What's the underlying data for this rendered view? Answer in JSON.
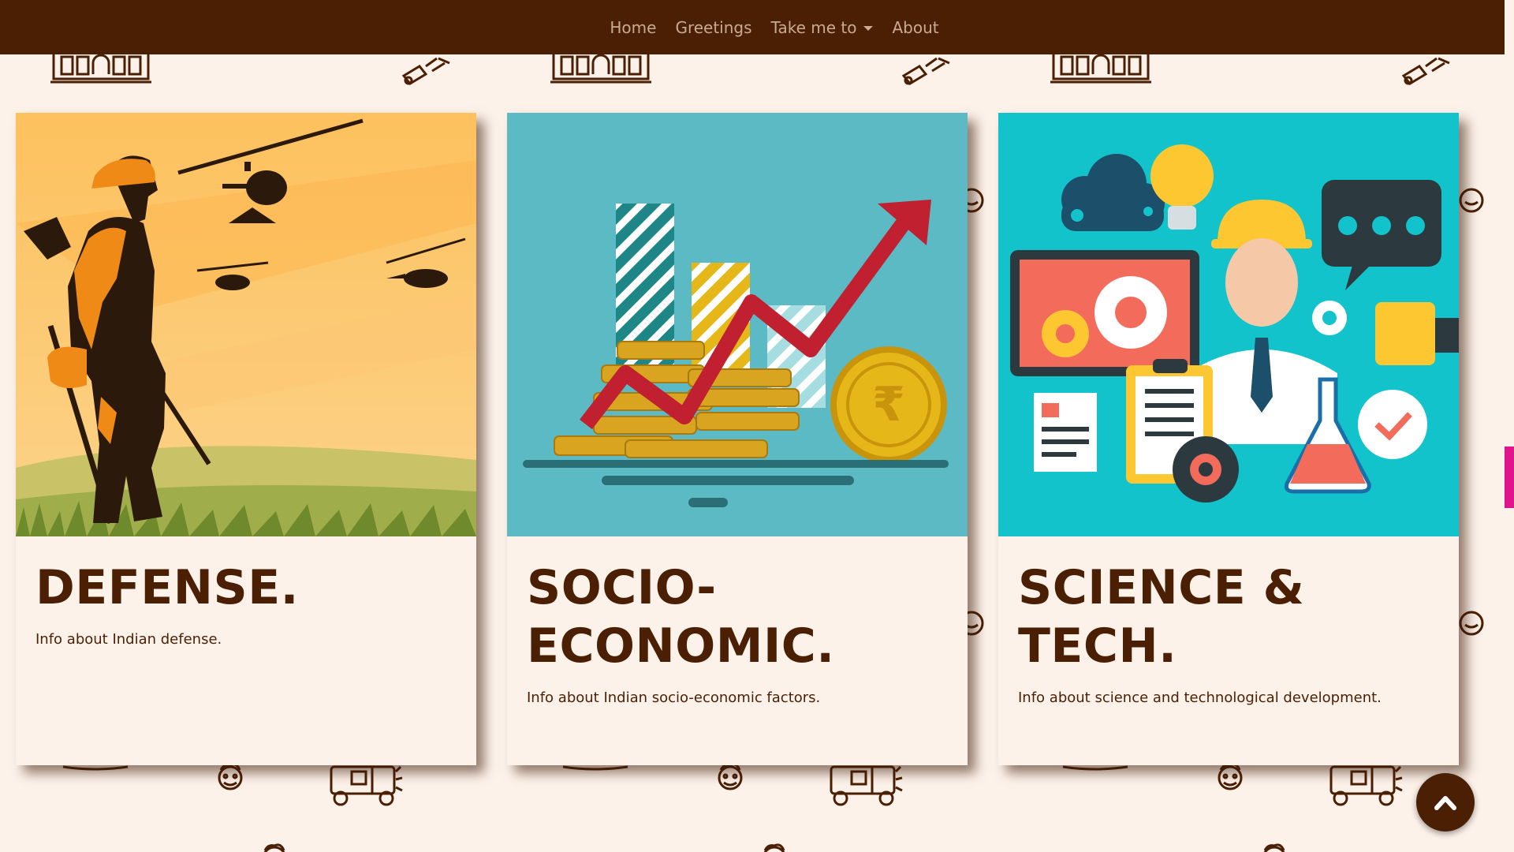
{
  "nav": {
    "items": [
      {
        "label": "Home"
      },
      {
        "label": "Greetings"
      },
      {
        "label": "Take me to",
        "dropdown": true
      },
      {
        "label": "About"
      }
    ]
  },
  "cards": [
    {
      "title": "DEFENSE.",
      "text": "Info about Indian defense.",
      "image": "soldier-helicopters-illustration"
    },
    {
      "title": "SOCIO-ECONOMIC.",
      "title_lines": [
        "SOCIO-",
        "ECONOMIC."
      ],
      "text": "Info about Indian socio-economic factors.",
      "image": "coins-growth-chart-illustration",
      "currency_symbol": "₹"
    },
    {
      "title": "SCIENCE & TECH.",
      "text": "Info about science and technological development.",
      "image": "scientist-tech-icons-illustration"
    }
  ],
  "scroll_top_button": {
    "icon": "chevron-up-icon"
  },
  "colors": {
    "navbar": "#4a1f04",
    "nav_text": "#c9aa92",
    "page_bg": "#fdf2ea",
    "heading": "#4a1f04",
    "scroll_thumb": "#e0148c"
  }
}
